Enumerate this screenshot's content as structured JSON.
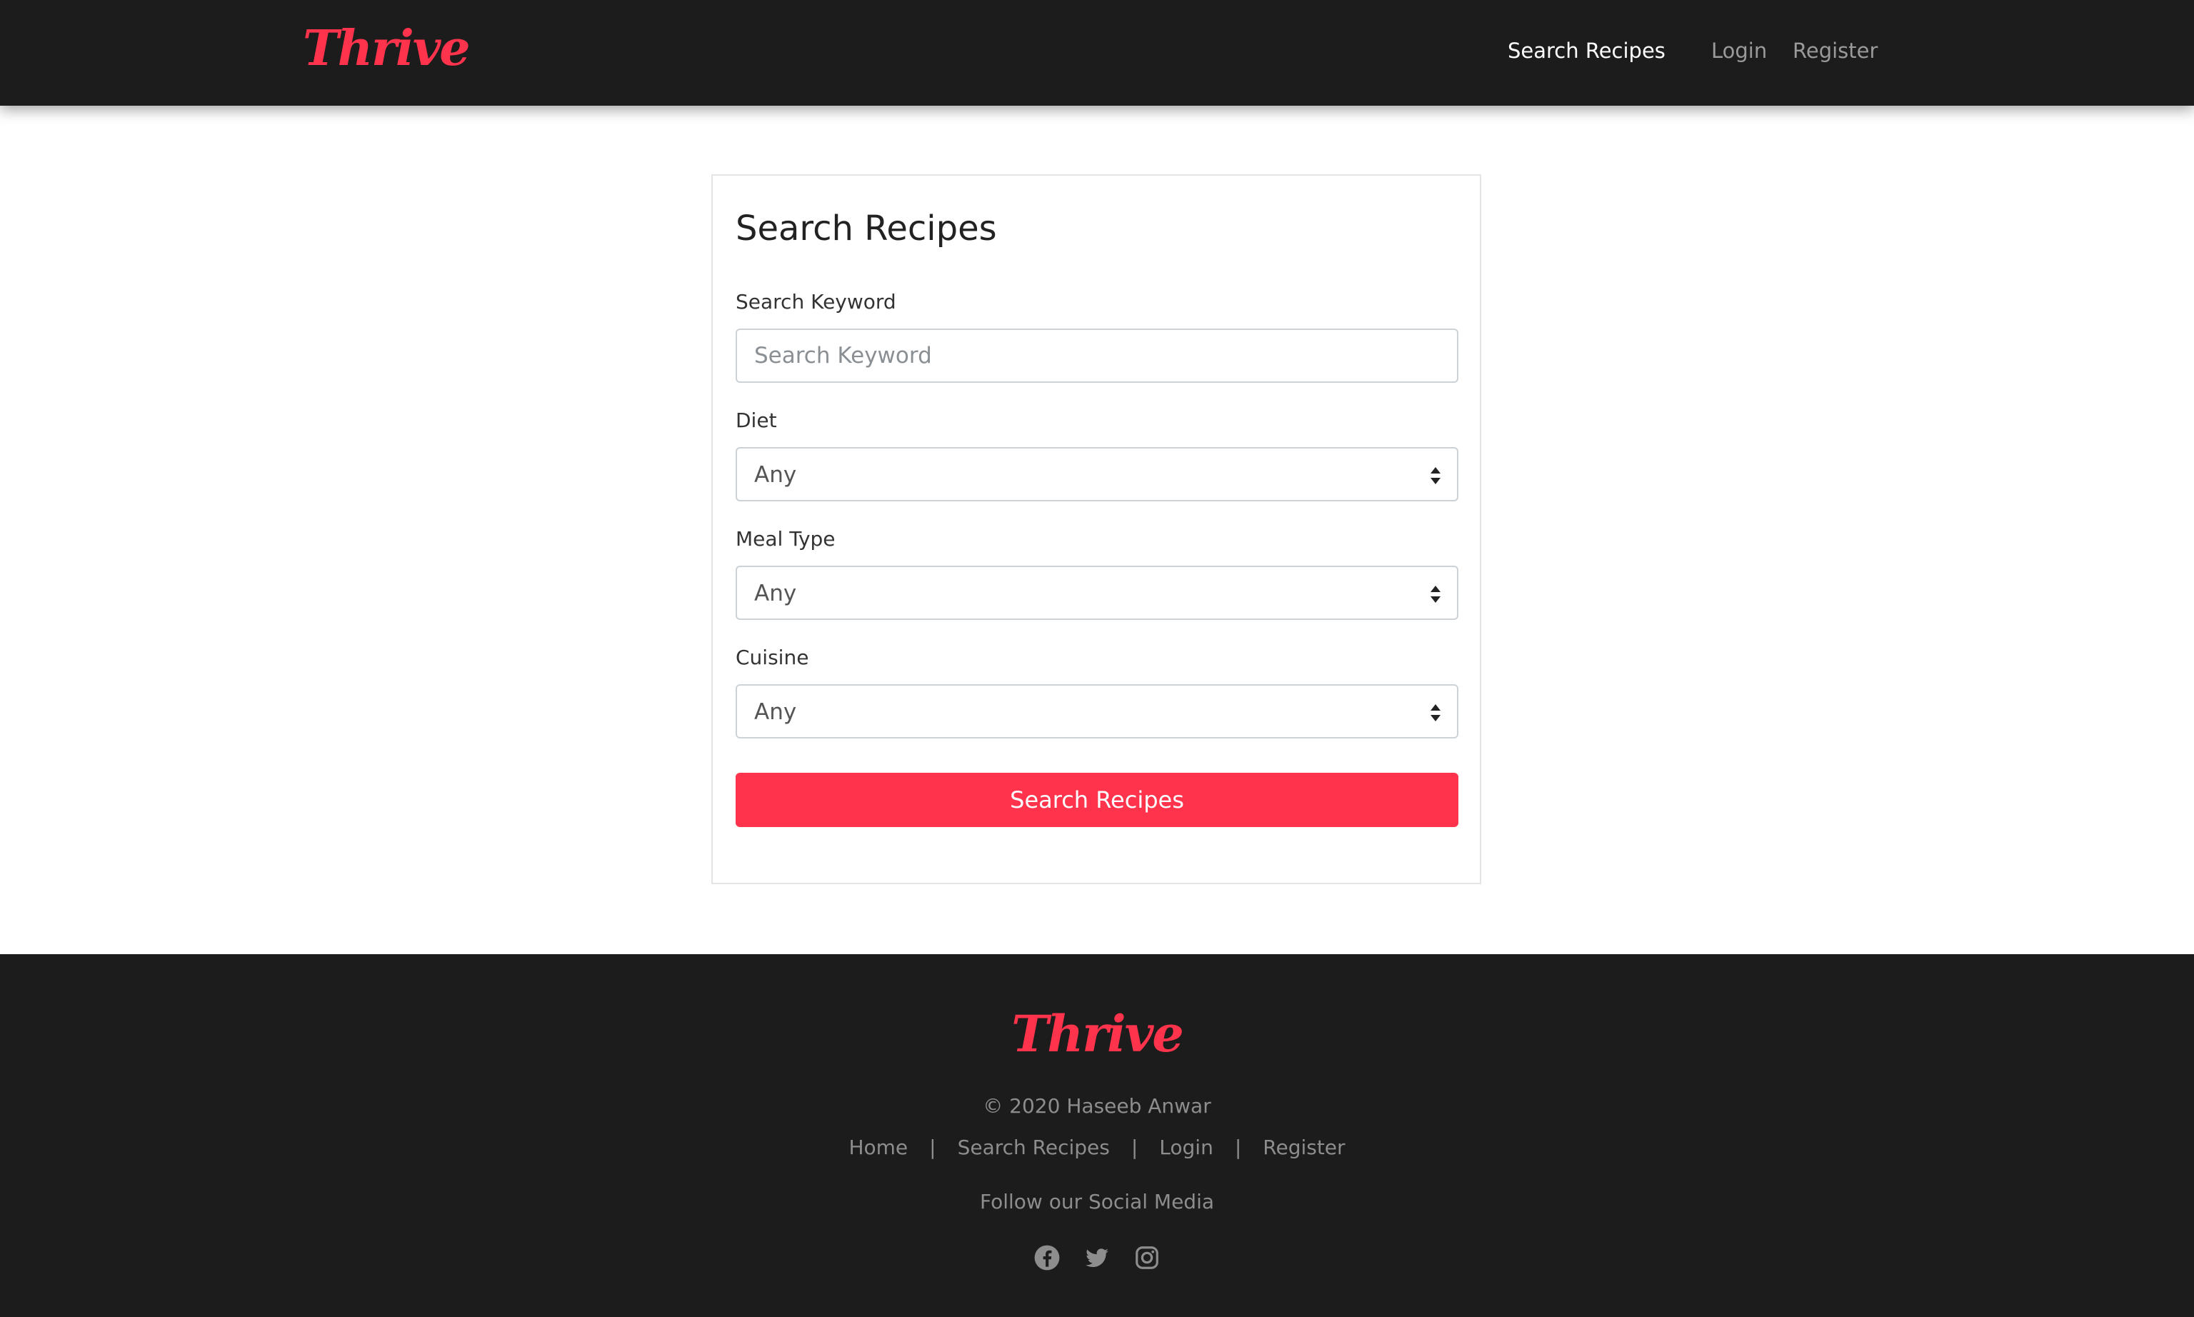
{
  "colors": {
    "brand": "#ff334b",
    "dark": "#1c1c1d",
    "icon": "#8d8d8d"
  },
  "header": {
    "brand": "Thrive",
    "nav": {
      "search": "Search Recipes",
      "login": "Login",
      "register": "Register"
    }
  },
  "form": {
    "title": "Search Recipes",
    "keyword": {
      "label": "Search Keyword",
      "placeholder": "Search Keyword",
      "value": ""
    },
    "diet": {
      "label": "Diet",
      "value": "Any"
    },
    "meal_type": {
      "label": "Meal Type",
      "value": "Any"
    },
    "cuisine": {
      "label": "Cuisine",
      "value": "Any"
    },
    "submit_label": "Search Recipes"
  },
  "footer": {
    "brand": "Thrive",
    "copyright": "© 2020 Haseeb Anwar",
    "links": [
      "Home",
      "Search Recipes",
      "Login",
      "Register"
    ],
    "separator": "|",
    "follow_text": "Follow our Social Media",
    "social_icons": [
      "facebook-icon",
      "twitter-icon",
      "instagram-icon"
    ]
  }
}
